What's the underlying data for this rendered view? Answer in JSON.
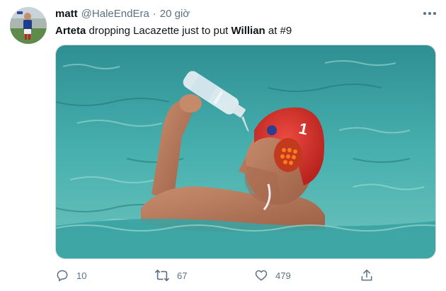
{
  "tweet": {
    "display_name": "matt",
    "handle": "@HaleEndEra",
    "separator": "·",
    "time": "20 giờ",
    "text_parts": [
      {
        "text": "Arteta",
        "bold": true
      },
      {
        "text": " dropping Lacazette just to put ",
        "bold": false
      },
      {
        "text": "Willian",
        "bold": true
      },
      {
        "text": " at #9",
        "bold": false
      }
    ],
    "cap_number": "1",
    "actions": {
      "reply": {
        "icon": "reply-icon",
        "count": "10"
      },
      "retweet": {
        "icon": "retweet-icon",
        "count": "67"
      },
      "like": {
        "icon": "heart-icon",
        "count": "479"
      },
      "share": {
        "icon": "share-icon"
      }
    }
  },
  "colors": {
    "text": "#0f1419",
    "secondary": "#5b7083",
    "pool": "#3fa9a8",
    "cap": "#d6312b"
  }
}
